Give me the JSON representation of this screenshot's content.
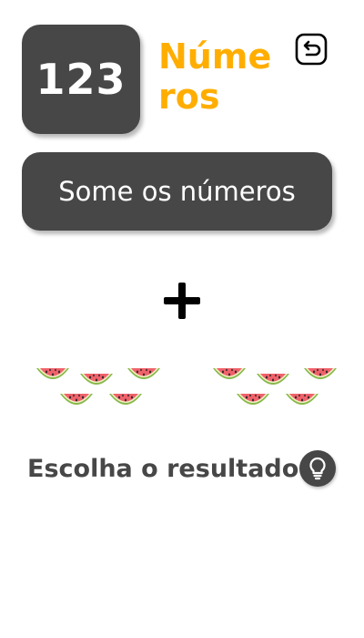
{
  "header": {
    "logo_text": "123",
    "app_title": "Números",
    "back_icon": "back-return-icon"
  },
  "instruction": "Some os números",
  "operator_icon": "plus-icon",
  "groups": [
    {
      "item_icon": "watermelon-icon",
      "count": 5
    },
    {
      "item_icon": "watermelon-icon",
      "count": 5
    }
  ],
  "prompt": "Escolha o resultado",
  "hint_icon": "lightbulb-icon",
  "colors": {
    "accent": "#FFAE00",
    "tile": "#474747",
    "text": "#474747",
    "background": "#FFFFFF"
  }
}
